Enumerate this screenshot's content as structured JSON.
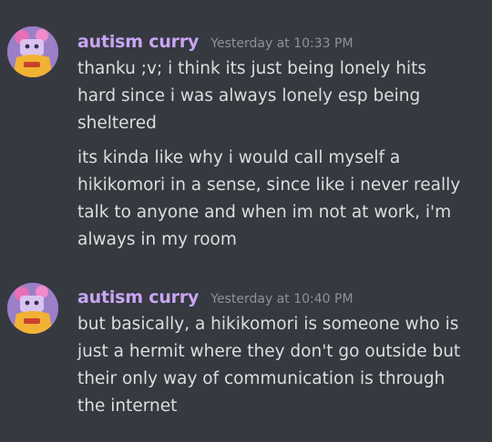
{
  "colors": {
    "background": "#36393f",
    "username": "#c9a5f5",
    "timestamp": "#8e9297",
    "message_text": "#dcddde"
  },
  "messages": [
    {
      "author": "autism curry",
      "avatar_icon": "user-avatar-icon",
      "timestamp": "Yesterday at 10:33 PM",
      "paragraphs": [
        {
          "lines": [
            "thanku ;v; i think its just being lonely hits",
            "hard since i was always lonely esp being",
            "sheltered"
          ]
        },
        {
          "lines": [
            "its kinda like why i would call myself a",
            "hikikomori in a sense, since like i never really",
            "talk to anyone and when im not at work, i'm",
            "always in my room"
          ]
        }
      ]
    },
    {
      "author": "autism curry",
      "avatar_icon": "user-avatar-icon",
      "timestamp": "Yesterday at 10:40 PM",
      "paragraphs": [
        {
          "lines": [
            "but basically, a hikikomori is someone who is",
            "just a hermit where they don't go outside but",
            "their only way of communication is through",
            "the internet"
          ]
        }
      ]
    }
  ]
}
